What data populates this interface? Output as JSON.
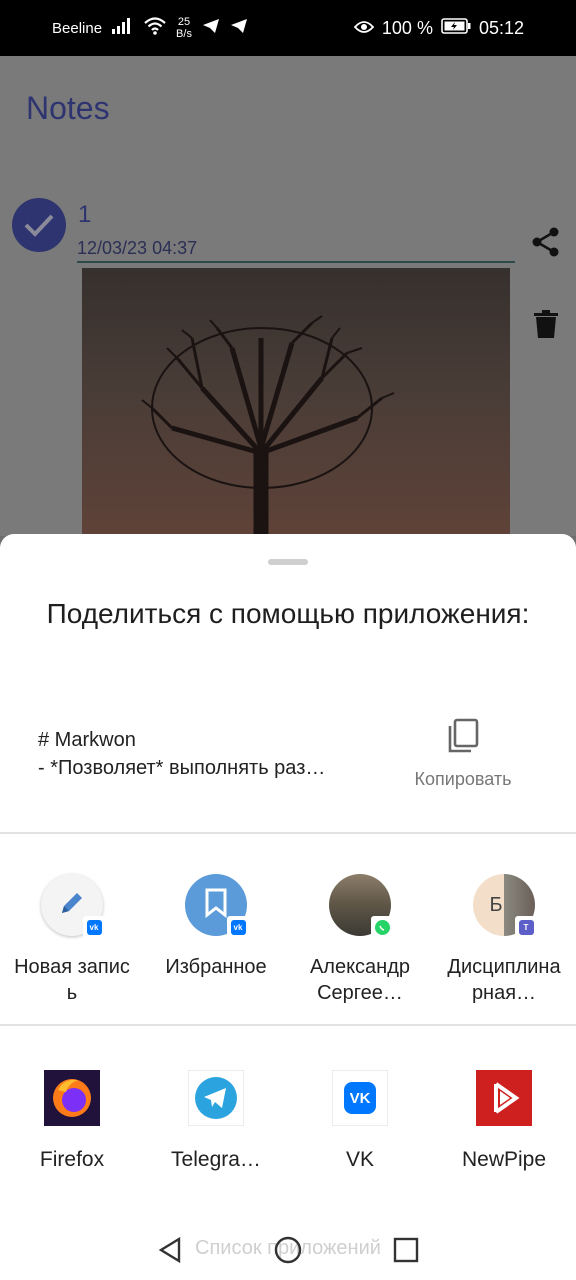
{
  "status_bar": {
    "carrier": "Beeline",
    "net_speed_value": "25",
    "net_speed_unit": "B/s",
    "battery": "100 %",
    "time": "05:12"
  },
  "app": {
    "title": "Notes",
    "note": {
      "title": "1",
      "date": "12/03/23 04:37"
    }
  },
  "share_sheet": {
    "title": "Поделиться с помощью приложения:",
    "preview_line1": "# Markwon",
    "preview_line2": "- *Позволяет* выполнять раз…",
    "copy_label": "Копировать",
    "direct_targets": [
      {
        "label": "Новая запись",
        "badge": "vk"
      },
      {
        "label": "Избранное",
        "badge": "vk"
      },
      {
        "label": "Александр Сергее…",
        "badge": "whatsapp"
      },
      {
        "label": "Дисциплинарная…",
        "badge": "teams",
        "avatar_letter": "Б"
      }
    ],
    "apps": [
      {
        "label": "Firefox"
      },
      {
        "label": "Telegra…"
      },
      {
        "label": "VK"
      },
      {
        "label": "NewPipe"
      }
    ],
    "apps_list_label": "Список приложений"
  },
  "colors": {
    "accent": "#2e3470",
    "vk_blue": "#0077ff",
    "telegram_blue": "#2aa3df",
    "newpipe_red": "#cd201f",
    "whatsapp_green": "#25d366"
  }
}
